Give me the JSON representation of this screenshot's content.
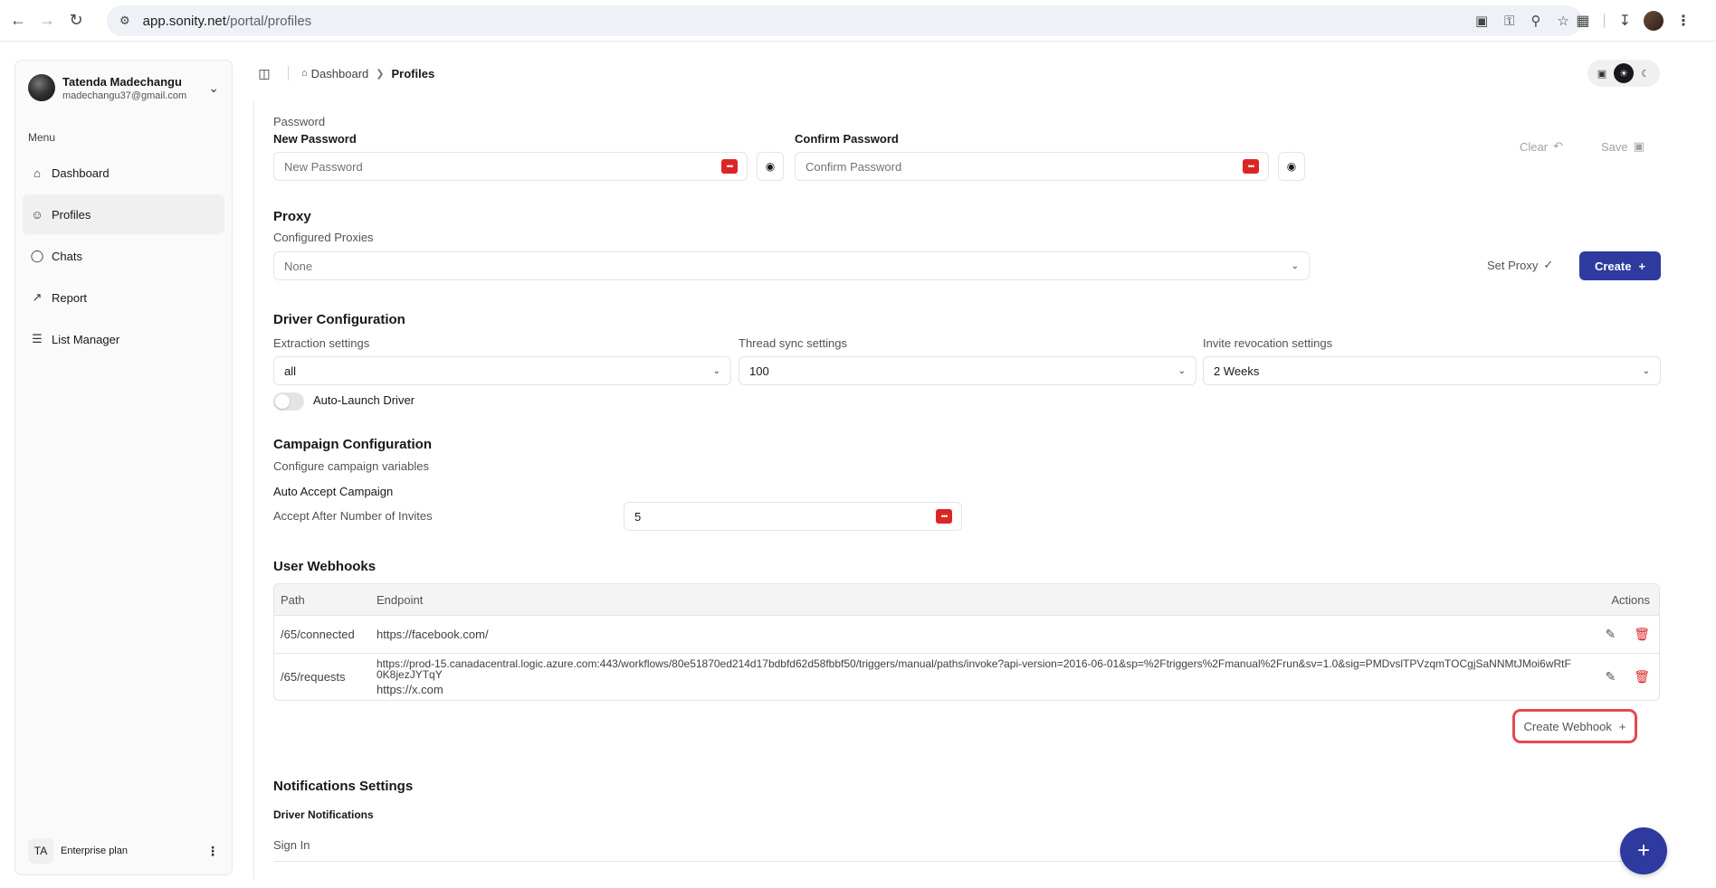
{
  "browser": {
    "url_domain": "app.sonity.net",
    "url_path": "/portal/profiles"
  },
  "sidebar": {
    "user_name": "Tatenda Madechangu",
    "user_email": "madechangu37@gmail.com",
    "menu_label": "Menu",
    "items": [
      {
        "label": "Dashboard",
        "icon": "home-icon"
      },
      {
        "label": "Profiles",
        "icon": "users-icon",
        "active": true
      },
      {
        "label": "Chats",
        "icon": "chat-icon"
      },
      {
        "label": "Report",
        "icon": "chart-icon"
      },
      {
        "label": "List Manager",
        "icon": "list-icon"
      }
    ],
    "plan_initials": "TA",
    "plan_name": "Enterprise plan"
  },
  "breadcrumb": {
    "home": "Dashboard",
    "current": "Profiles"
  },
  "password": {
    "section": "Password",
    "new_label": "New Password",
    "new_placeholder": "New Password",
    "confirm_label": "Confirm Password",
    "confirm_placeholder": "Confirm Password",
    "clear_label": "Clear",
    "save_label": "Save"
  },
  "proxy": {
    "title": "Proxy",
    "configured_label": "Configured Proxies",
    "selected": "None",
    "set_label": "Set Proxy",
    "create_label": "Create"
  },
  "driver": {
    "title": "Driver Configuration",
    "extraction_label": "Extraction settings",
    "extraction_value": "all",
    "thread_label": "Thread sync settings",
    "thread_value": "100",
    "invite_label": "Invite revocation settings",
    "invite_value": "2 Weeks",
    "auto_launch_label": "Auto-Launch Driver",
    "auto_launch_on": false
  },
  "campaign": {
    "title": "Campaign Configuration",
    "subtitle": "Configure campaign variables",
    "auto_accept_label": "Auto Accept Campaign",
    "accept_after_label": "Accept After Number of Invites",
    "accept_after_value": "5"
  },
  "webhooks": {
    "title": "User Webhooks",
    "columns": {
      "path": "Path",
      "endpoint": "Endpoint",
      "actions": "Actions"
    },
    "rows": [
      {
        "path": "/65/connected",
        "endpoint": "https://facebook.com/"
      },
      {
        "path": "/65/requests",
        "endpoint": "https://prod-15.canadacentral.logic.azure.com:443/workflows/80e51870ed214d17bdbfd62d58fbbf50/triggers/manual/paths/invoke?api-version=2016-06-01&sp=%2Ftriggers%2Fmanual%2Frun&sv=1.0&sig=PMDvslTPVzqmTOCgjSaNNMtJMoi6wRtF0K8jezJYTqY",
        "endpoint2": "https://x.com"
      }
    ],
    "create_label": "Create Webhook"
  },
  "notifications": {
    "title": "Notifications Settings",
    "driver_label": "Driver Notifications",
    "sign_in_label": "Sign In",
    "sign_in_on": true
  },
  "colors": {
    "primary": "#2e3a9e",
    "danger": "#dc2626",
    "highlight": "#e5484d"
  }
}
